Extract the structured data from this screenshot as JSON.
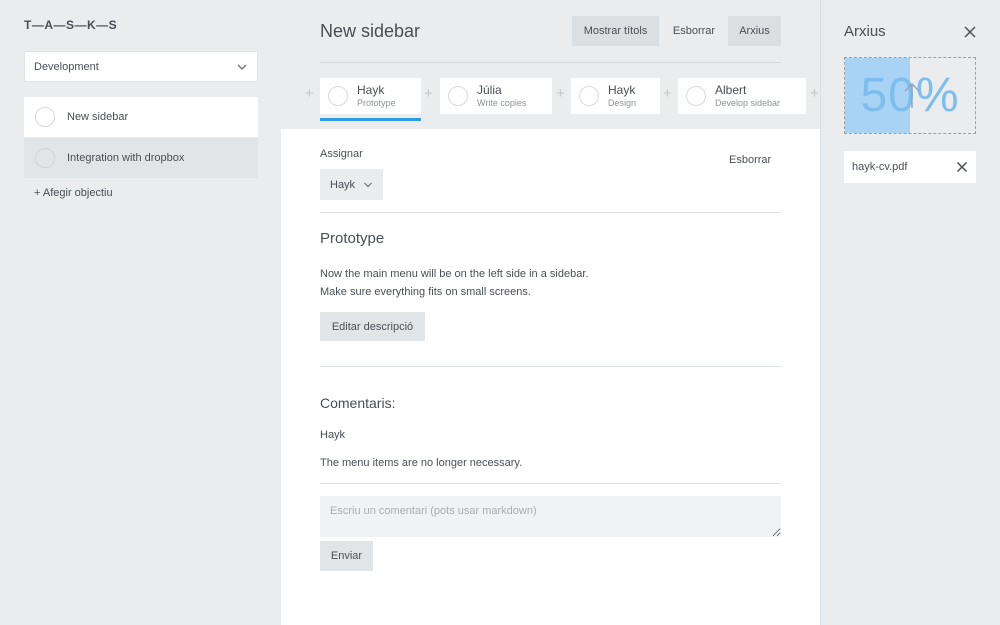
{
  "app": {
    "logo": "T—A—S—K—S"
  },
  "sidebar": {
    "project": "Development",
    "goals": [
      {
        "label": "New sidebar"
      },
      {
        "label": "Integration with dropbox"
      }
    ],
    "add_goal": "+ Afegir objectiu"
  },
  "header": {
    "title": "New sidebar",
    "show_titles": "Mostrar títols",
    "delete": "Esborrar",
    "archive": "Arxius"
  },
  "tasks": [
    {
      "name": "Hayk",
      "sub": "Prototype"
    },
    {
      "name": "Júlia",
      "sub": "Write copies"
    },
    {
      "name": "Hayk",
      "sub": "Design"
    },
    {
      "name": "Albert",
      "sub": "Develop sidebar"
    }
  ],
  "detail": {
    "assign_label": "Assignar",
    "delete": "Esborrar",
    "assignee": "Hayk",
    "title": "Prototype",
    "desc_line1": "Now the main menu will be on the left side in a sidebar.",
    "desc_line2": "Make sure everything fits on small screens.",
    "edit_btn": "Editar descripció",
    "comments_heading": "Comentaris:",
    "comment_author": "Hayk",
    "comment_text": "The menu items are no longer necessary.",
    "comment_placeholder": "Escriu un comentari (pots usar markdown)",
    "send_btn": "Enviar"
  },
  "files": {
    "title": "Arxius",
    "upload_percent_label": "50%",
    "upload_progress": 0.5,
    "items": [
      {
        "name": "hayk-cv.pdf"
      }
    ]
  },
  "colors": {
    "accent": "#2e9be6",
    "upload_fill": "#a9d3f5"
  }
}
